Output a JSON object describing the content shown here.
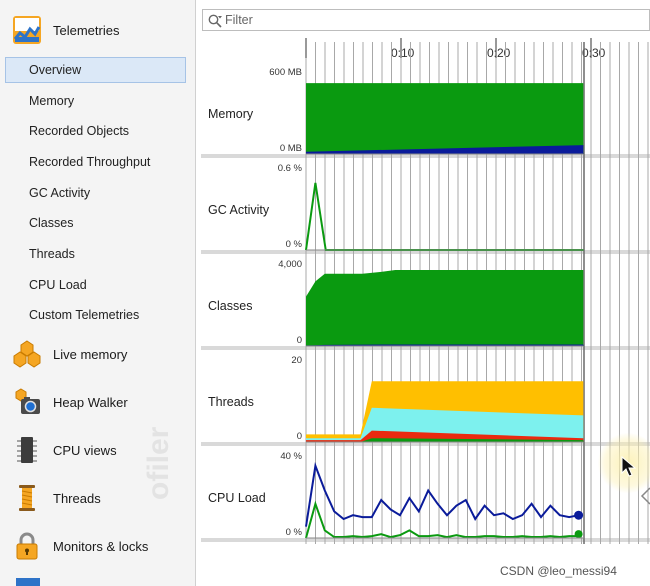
{
  "sidebar": {
    "sections": [
      {
        "label": "Telemetries",
        "icon": "telemetries-icon"
      },
      {
        "label": "Live memory",
        "icon": "live-memory-icon"
      },
      {
        "label": "Heap Walker",
        "icon": "heap-walker-icon"
      },
      {
        "label": "CPU views",
        "icon": "cpu-views-icon"
      },
      {
        "label": "Threads",
        "icon": "threads-icon"
      },
      {
        "label": "Monitors & locks",
        "icon": "monitors-locks-icon"
      }
    ],
    "telemetry_items": [
      {
        "label": "Overview",
        "selected": true
      },
      {
        "label": "Memory"
      },
      {
        "label": "Recorded Objects"
      },
      {
        "label": "Recorded Throughput"
      },
      {
        "label": "GC Activity"
      },
      {
        "label": "Classes"
      },
      {
        "label": "Threads"
      },
      {
        "label": "CPU Load"
      },
      {
        "label": "Custom Telemetries"
      }
    ],
    "watermark": "ofiler"
  },
  "filter": {
    "placeholder": "Filter"
  },
  "timeline": {
    "ticks": [
      "0:10",
      "0:20",
      "0:30"
    ]
  },
  "charts": [
    {
      "name": "Memory",
      "y_top": "600 MB",
      "y_bottom": "0 MB"
    },
    {
      "name": "GC Activity",
      "y_top": "0.6 %",
      "y_bottom": "0 %"
    },
    {
      "name": "Classes",
      "y_top": "4,000",
      "y_bottom": "0"
    },
    {
      "name": "Threads",
      "y_top": "20",
      "y_bottom": "0"
    },
    {
      "name": "CPU Load",
      "y_top": "40 %",
      "y_bottom": "0 %"
    }
  ],
  "colors": {
    "green": "#0a9a10",
    "navy": "#0a1b9a",
    "yellow": "#ffbf00",
    "cyan": "#7df1ee",
    "red": "#ea2a10",
    "grid": "#a8a8a8",
    "selection": "#dbe8f7"
  },
  "chart_data": [
    {
      "type": "area",
      "title": "Memory",
      "ylim": [
        0,
        600
      ],
      "x": [
        0,
        29.5
      ],
      "series": [
        {
          "values": [
            560,
            560
          ]
        },
        {
          "values": [
            18,
            70
          ]
        }
      ]
    },
    {
      "type": "line",
      "title": "GC Activity",
      "ylim": [
        0,
        0.6
      ],
      "x": [
        0,
        1.0,
        2.1,
        29.5
      ],
      "series": [
        {
          "values": [
            0.0,
            0.53,
            0.0,
            0.0
          ]
        }
      ]
    },
    {
      "type": "area",
      "title": "Classes",
      "ylim": [
        0,
        4000
      ],
      "x": [
        0,
        1.0,
        2.0,
        6.0,
        8.0,
        9.5,
        29.5
      ],
      "series": [
        {
          "values": [
            2600,
            3400,
            3800,
            3800,
            3900,
            4000,
            4000
          ]
        },
        {
          "values": [
            30,
            40,
            60,
            70,
            80,
            80,
            80
          ]
        }
      ]
    },
    {
      "type": "area",
      "title": "Threads",
      "ylim": [
        0,
        20
      ],
      "x": [
        0,
        5.8,
        7.0,
        29.5
      ],
      "series": [
        {
          "values": [
            2,
            2,
            16,
            16
          ]
        },
        {
          "values": [
            1,
            1,
            9,
            7
          ]
        },
        {
          "values": [
            0.5,
            0.5,
            3,
            1
          ]
        },
        {
          "values": [
            0,
            0,
            1,
            0.5
          ]
        }
      ]
    },
    {
      "type": "line",
      "title": "CPU Load",
      "ylim": [
        0,
        40
      ],
      "x": [
        0,
        1,
        2,
        3,
        4,
        5,
        6,
        7,
        8,
        9,
        10,
        11,
        12,
        13,
        14,
        15,
        16,
        17,
        18,
        19,
        20,
        21,
        22,
        23,
        24,
        25,
        26,
        27,
        28,
        29
      ],
      "series": [
        {
          "values": [
            6,
            38,
            25,
            14,
            10,
            12,
            11,
            11,
            20,
            15,
            12,
            21,
            14,
            25,
            18,
            12,
            17,
            20,
            10,
            17,
            12,
            13,
            10,
            12,
            18,
            11,
            17,
            12,
            11,
            12
          ]
        },
        {
          "values": [
            0,
            18,
            4,
            0.5,
            0.5,
            1,
            0.5,
            1,
            2,
            0.5,
            1.5,
            4,
            1,
            1,
            1.5,
            0.5,
            1.5,
            0.5,
            0.5,
            1,
            1,
            0.5,
            0.5,
            1,
            0.5,
            0.5,
            1,
            0.5,
            1,
            1
          ]
        }
      ]
    }
  ],
  "credit": "CSDN @leo_messi94"
}
